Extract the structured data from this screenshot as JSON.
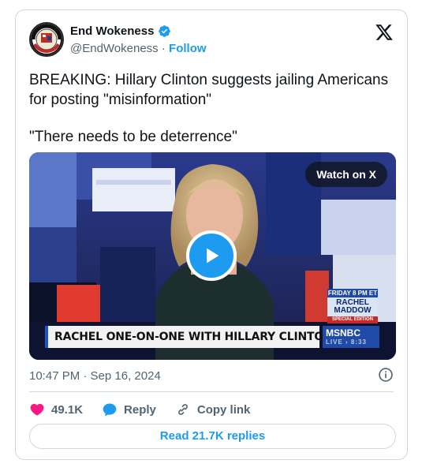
{
  "author": {
    "display_name": "End Wokeness",
    "handle": "@EndWokeness",
    "separator": "·",
    "follow_label": "Follow"
  },
  "tweet": {
    "line1": "BREAKING: Hillary Clinton suggests jailing Americans for posting \"misinformation\"",
    "line2": "\"There needs to be deterrence\""
  },
  "media": {
    "watch_label": "Watch on X",
    "chyron": "RACHEL ONE-ON-ONE WITH HILLARY CLINTON",
    "network": "MSNBC",
    "live": "LIVE",
    "live_time": "8:33",
    "promo_day": "FRIDAY 8 PM ET",
    "promo_name": "RACHEL MADDOW",
    "promo_edition": "SPECIAL EDITION"
  },
  "meta": {
    "timestamp": "10:47 PM · Sep 16, 2024"
  },
  "actions": {
    "likes": "49.1K",
    "reply_label": "Reply",
    "copy_label": "Copy link",
    "read_replies": "Read 21.7K replies"
  },
  "colors": {
    "accent": "#1d9bf0",
    "like": "#f91880",
    "muted": "#536471",
    "border": "#cfd9de"
  }
}
